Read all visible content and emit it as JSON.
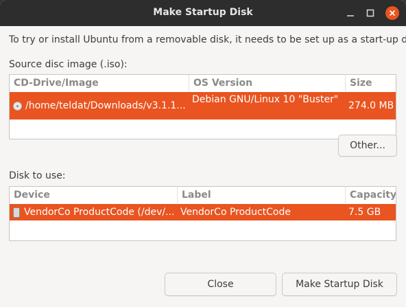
{
  "window": {
    "title": "Make Startup Disk"
  },
  "intro_text": "To try or install Ubuntu from a removable disk, it needs to be set up as a start-up disk.",
  "source": {
    "label": "Source disc image (.iso):",
    "columns": [
      "CD-Drive/Image",
      "OS Version",
      "Size"
    ],
    "rows": [
      {
        "icon": "disc-icon",
        "image": "/home/teldat/Downloads/v3.1.1....",
        "os_version": "Debian GNU/Linux 10 \"Buster\" ...",
        "size": "274.0 MB",
        "selected": true
      }
    ],
    "other_button": "Other..."
  },
  "disk": {
    "label": "Disk to use:",
    "columns": [
      "Device",
      "Label",
      "Capacity"
    ],
    "rows": [
      {
        "icon": "usb-drive-icon",
        "device": "VendorCo ProductCode (/dev/...",
        "label": "VendorCo ProductCode",
        "capacity": "7.5 GB",
        "selected": true
      }
    ]
  },
  "buttons": {
    "close": "Close",
    "make": "Make Startup Disk"
  },
  "colors": {
    "selection": "#e95420",
    "titlebar": "#2d2d2d"
  }
}
